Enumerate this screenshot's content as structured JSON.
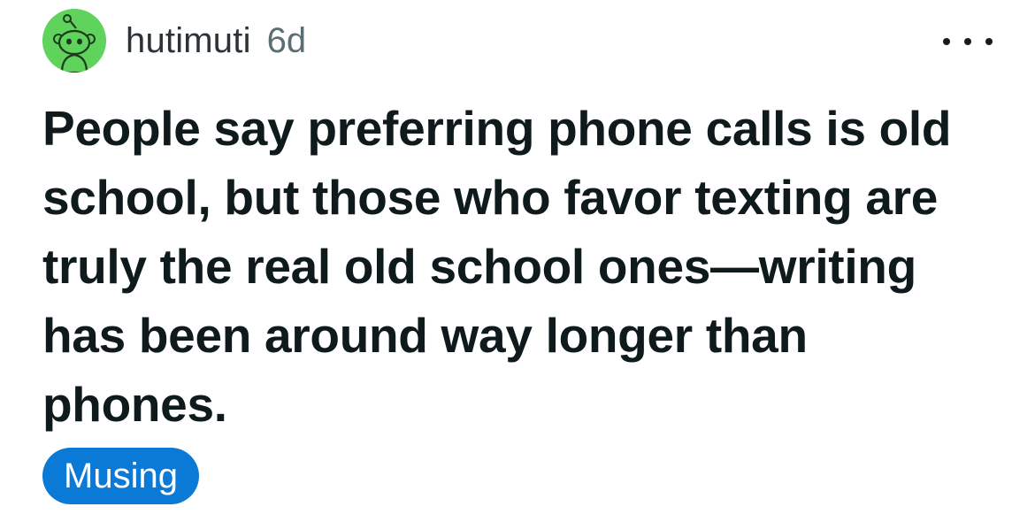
{
  "post": {
    "author": "hutimuti",
    "age": "6d",
    "avatar_icon": "snoo-avatar-icon",
    "more_icon": "more-options-icon",
    "title": "People say preferring phone calls is old school, but those who favor texting are truly the real old school ones—writing has been around way longer than phones.",
    "flair": {
      "label": "Musing",
      "color": "#0a7ad6"
    }
  },
  "colors": {
    "avatar_bg": "#5fd35b",
    "text": "#0f1a1c",
    "meta": "#5c6c74"
  }
}
